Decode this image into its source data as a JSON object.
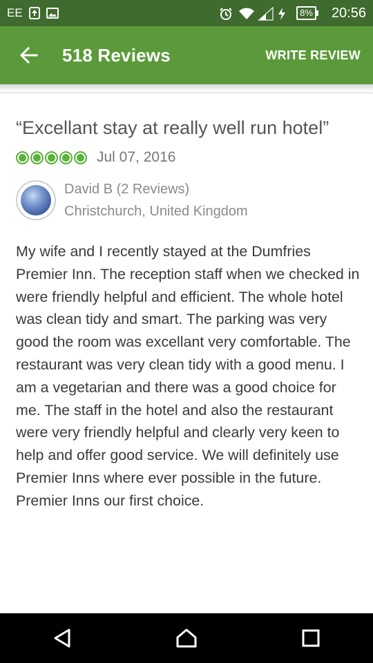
{
  "status_bar": {
    "carrier": "EE",
    "battery": "8%",
    "time": "20:56",
    "icons": [
      "upload-icon",
      "image-icon",
      "alarm-icon",
      "wifi-icon",
      "signal-icon",
      "charging-icon",
      "battery-icon"
    ]
  },
  "app_bar": {
    "title": "518 Reviews",
    "action_label": "WRITE REVIEW",
    "color": "#5b9a3a"
  },
  "review": {
    "title": "“Excellant stay at really well run hotel”",
    "rating": 5,
    "rating_max": 5,
    "date": "Jul 07, 2016",
    "reviewer_name": "David B",
    "reviewer_count": "(2 Reviews)",
    "reviewer_location": "Christchurch, United Kingdom",
    "body": "My wife and I recently stayed at the Dumfries Premier Inn.  The reception staff when we checked in were friendly helpful and efficient. The whole hotel was clean tidy and smart. The parking was very good the room was excellant very comfortable. The restaurant was very clean tidy with a good menu. I am a vegetarian and there was a good choice for me.  The staff in the hotel and also the restaurant were very friendly helpful and clearly very keen to help and offer good service.  We will definitely use Premier Inns where ever possible in the future. Premier Inns our first choice."
  },
  "nav_bar": {
    "icons": [
      "back-triangle-icon",
      "home-icon",
      "recents-icon"
    ]
  }
}
